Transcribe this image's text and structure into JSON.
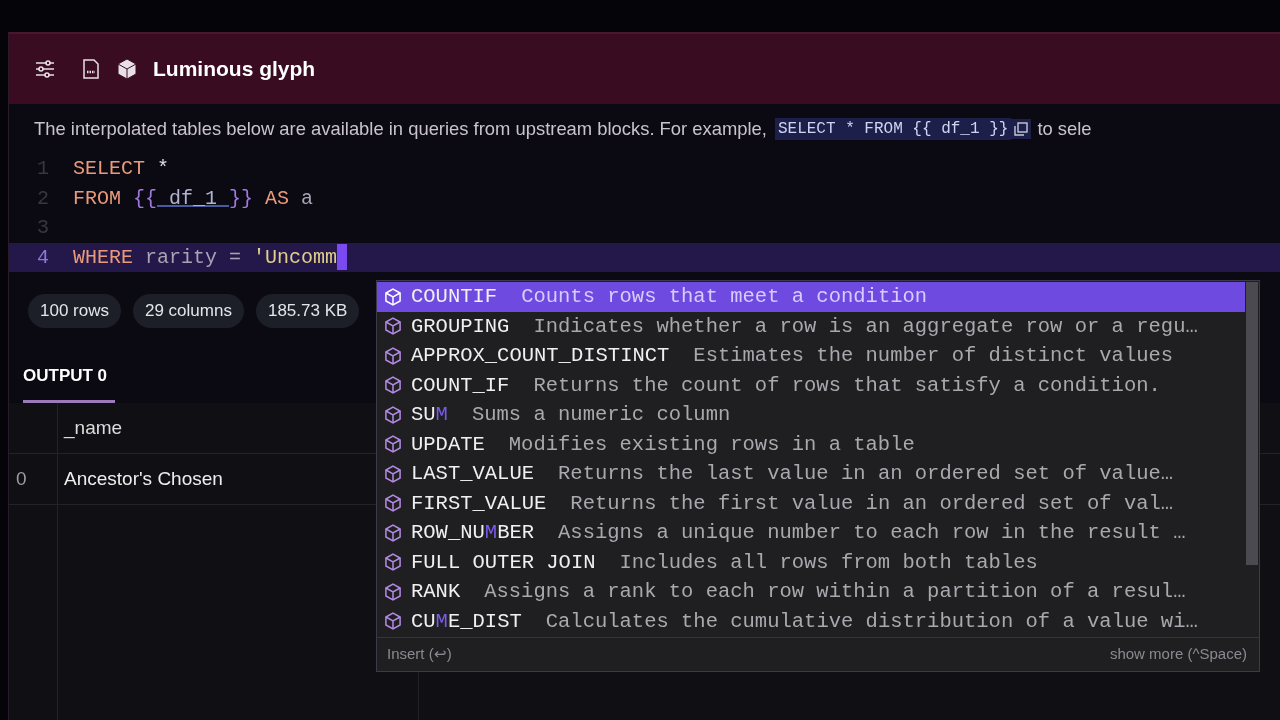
{
  "block": {
    "title": "Luminous glyph"
  },
  "description": {
    "text": "The interpolated tables below are available in queries from upstream blocks. For example,",
    "code": "SELECT * FROM {{ df_1 }}",
    "trailing": "to sele"
  },
  "editor": {
    "lines": [
      {
        "number": "1",
        "tokens": [
          {
            "kind": "keyword",
            "text": "SELECT"
          },
          {
            "kind": "plain",
            "text": " *"
          }
        ],
        "current": false
      },
      {
        "number": "2",
        "tokens": [
          {
            "kind": "keyword",
            "text": "FROM "
          },
          {
            "kind": "brace",
            "text": "{{"
          },
          {
            "kind": "ref",
            "text": " df_1 "
          },
          {
            "kind": "brace",
            "text": "}}"
          },
          {
            "kind": "keyword",
            "text": " AS"
          },
          {
            "kind": "ident",
            "text": " a"
          }
        ],
        "current": false
      },
      {
        "number": "3",
        "current": false
      },
      {
        "number": "4",
        "tokens": [
          {
            "kind": "keyword",
            "text": "WHERE"
          },
          {
            "kind": "ident",
            "text": " rarity = "
          },
          {
            "kind": "string",
            "text": "'Uncomm"
          }
        ],
        "current": true
      }
    ]
  },
  "stats": [
    "100 rows",
    "29 columns",
    "185.73 KB"
  ],
  "tabs": [
    {
      "label": "OUTPUT 0",
      "selected": true
    }
  ],
  "table": {
    "columns": [
      "_name"
    ],
    "rows": [
      {
        "index": "0",
        "cells": [
          "Ancestor's Chosen"
        ]
      }
    ]
  },
  "autocomplete": {
    "items": [
      {
        "name_parts": [
          {
            "text": "COUNTIF",
            "match": false
          }
        ],
        "detail": "Counts rows that meet a condition",
        "selected": true
      },
      {
        "name_parts": [
          {
            "text": "GROUPING",
            "match": false
          }
        ],
        "detail": "Indicates whether a row is an aggregate row or a regu…",
        "selected": false
      },
      {
        "name_parts": [
          {
            "text": "APPROX_COUNT_DISTINCT",
            "match": false
          }
        ],
        "detail": "Estimates the number of distinct values",
        "selected": false
      },
      {
        "name_parts": [
          {
            "text": "COUNT_IF",
            "match": false
          }
        ],
        "detail": "Returns the count of rows that satisfy a condition.",
        "selected": false
      },
      {
        "name_parts": [
          {
            "text": "SU",
            "match": false
          },
          {
            "text": "M",
            "match": true
          }
        ],
        "detail": "Sums a numeric column",
        "selected": false
      },
      {
        "name_parts": [
          {
            "text": "UPDATE",
            "match": false
          }
        ],
        "detail": "Modifies existing rows in a table",
        "selected": false
      },
      {
        "name_parts": [
          {
            "text": "LAST_VALUE",
            "match": false
          }
        ],
        "detail": "Returns the last value in an ordered set of value…",
        "selected": false
      },
      {
        "name_parts": [
          {
            "text": "FIRST_VALUE",
            "match": false
          }
        ],
        "detail": "Returns the first value in an ordered set of val…",
        "selected": false
      },
      {
        "name_parts": [
          {
            "text": "ROW_NU",
            "match": false
          },
          {
            "text": "M",
            "match": true
          },
          {
            "text": "BER",
            "match": false
          }
        ],
        "detail": "Assigns a unique number to each row in the result …",
        "selected": false
      },
      {
        "name_parts": [
          {
            "text": "FULL OUTER JOIN",
            "match": false
          }
        ],
        "detail": "Includes all rows from both tables",
        "selected": false
      },
      {
        "name_parts": [
          {
            "text": "RANK",
            "match": false
          }
        ],
        "detail": "Assigns a rank to each row within a partition of a resul…",
        "selected": false
      },
      {
        "name_parts": [
          {
            "text": "CU",
            "match": false
          },
          {
            "text": "M",
            "match": true
          },
          {
            "text": "E_DIST",
            "match": false
          }
        ],
        "detail": "Calculates the cumulative distribution of a value wi…",
        "selected": false
      }
    ],
    "footer_left": "Insert (↩)",
    "footer_right": "show more (^Space)"
  }
}
